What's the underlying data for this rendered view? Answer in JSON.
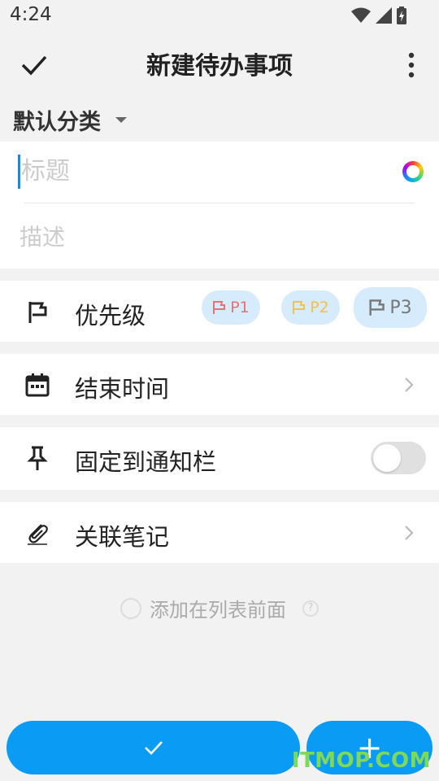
{
  "status_bar": {
    "time": "4:24"
  },
  "app_bar": {
    "title": "新建待办事项"
  },
  "category": {
    "label": "默认分类"
  },
  "input": {
    "title_placeholder": "标题",
    "description_placeholder": "描述"
  },
  "priority": {
    "label": "优先级",
    "options": [
      {
        "label": "P1",
        "color": "#e57373"
      },
      {
        "label": "P2",
        "color": "#f2c14e"
      },
      {
        "label": "P3",
        "color": "#777777",
        "selected": true
      }
    ]
  },
  "end_time": {
    "label": "结束时间"
  },
  "pin": {
    "label": "固定到通知栏",
    "on": false
  },
  "linked_note": {
    "label": "关联笔记"
  },
  "add_front": {
    "label": "添加在列表前面",
    "checked": false
  },
  "buttons": {
    "add_symbol": "+"
  },
  "watermark": "ITMOP.COM",
  "colors": {
    "accent": "#0a9cf5",
    "chip_bg": "#d6ebfb",
    "background": "#f2f2f2"
  }
}
